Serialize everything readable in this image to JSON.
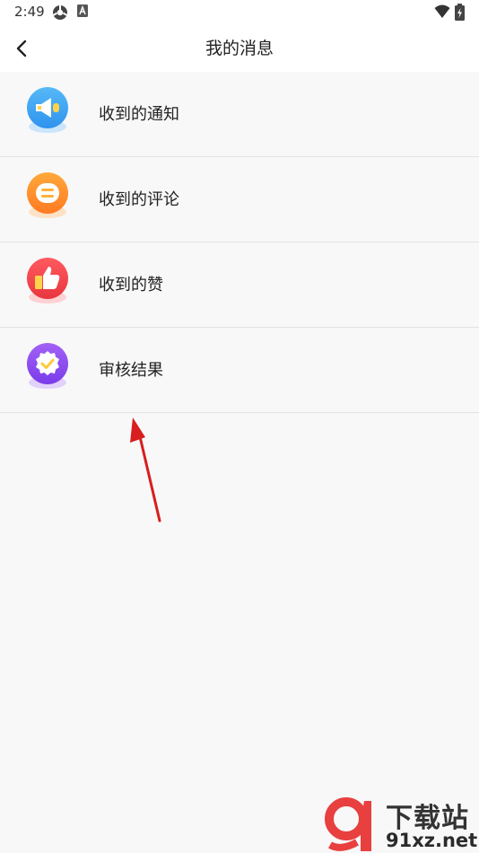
{
  "status_bar": {
    "time": "2:49"
  },
  "header": {
    "title": "我的消息",
    "back_icon": "chevron-left-icon"
  },
  "menu": {
    "items": [
      {
        "label": "收到的通知",
        "icon": "megaphone-icon",
        "color": "#3fa8f3"
      },
      {
        "label": "收到的评论",
        "icon": "comment-icon",
        "color": "#ff8a2a"
      },
      {
        "label": "收到的赞",
        "icon": "thumbs-up-icon",
        "color": "#f1454f"
      },
      {
        "label": "审核结果",
        "icon": "badge-check-icon",
        "color": "#8c4cf0"
      }
    ]
  },
  "annotation": {
    "arrow_color": "#d81e1e"
  },
  "watermark": {
    "title": "下载站",
    "domain": "91xz.net",
    "logo_color": "#e8403f"
  }
}
